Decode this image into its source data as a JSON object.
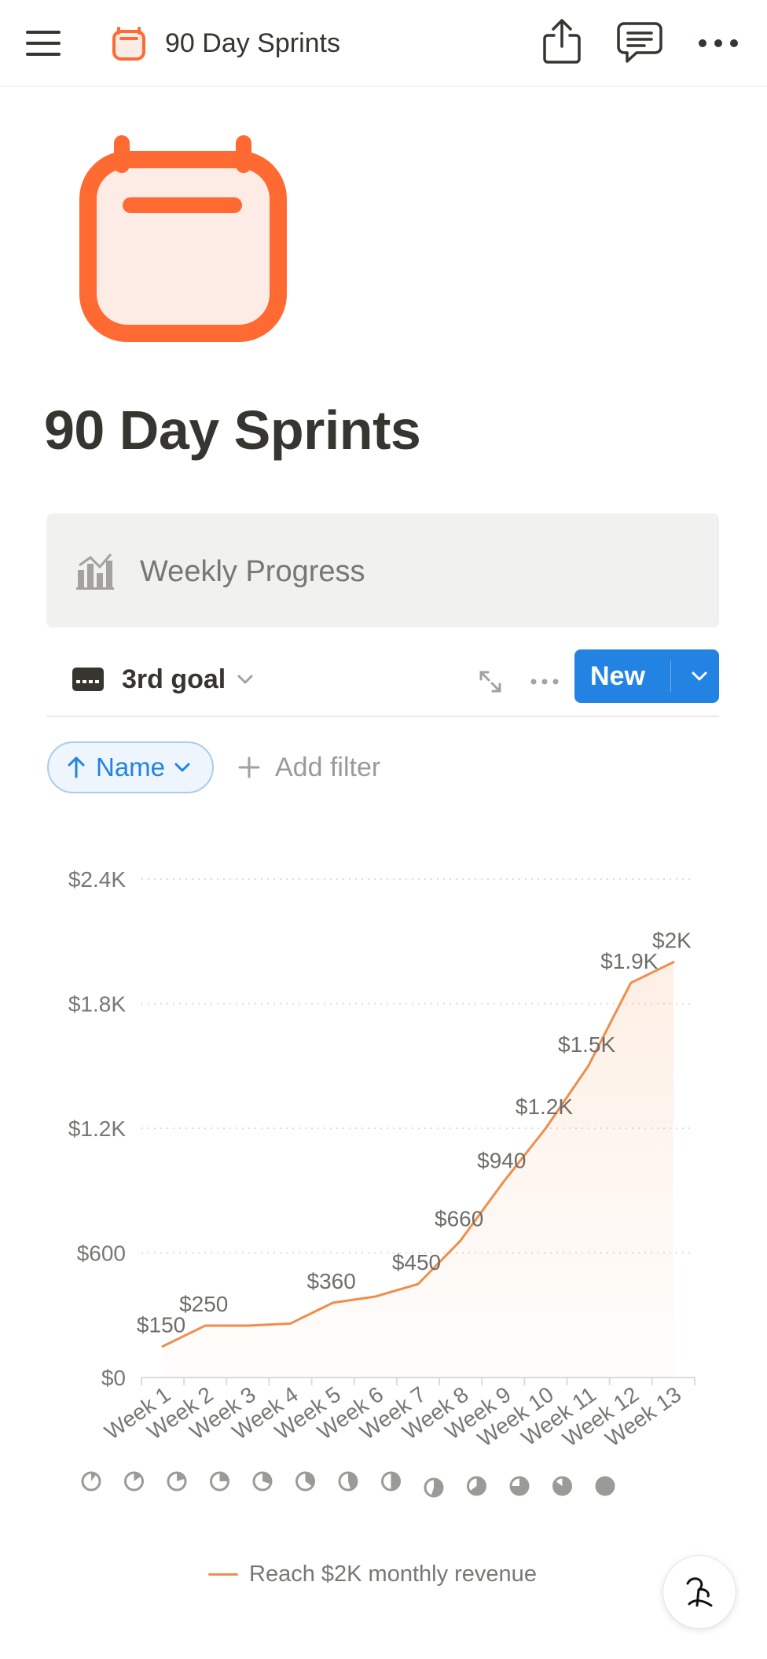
{
  "topbar": {
    "title": "90 Day Sprints",
    "icons": [
      "menu-icon",
      "calendar-icon",
      "share-icon",
      "comment-icon",
      "more-icon"
    ]
  },
  "page": {
    "title": "90 Day Sprints",
    "icon": "calendar-icon",
    "accent_color": "#ff6a33"
  },
  "database": {
    "title": "Weekly Progress",
    "icon": "chart-icon",
    "view": {
      "label": "3rd goal",
      "icon": "card-icon"
    },
    "new_label": "New",
    "new_color": "#2383e2",
    "sort": {
      "label": "Name",
      "direction": "ascending"
    },
    "add_filter_label": "Add filter"
  },
  "chart_data": {
    "type": "area",
    "categories": [
      "Week 1",
      "Week 2",
      "Week 3",
      "Week 4",
      "Week 5",
      "Week 6",
      "Week 7",
      "Week 8",
      "Week 9",
      "Week 10",
      "Week 11",
      "Week 12",
      "Week 13"
    ],
    "series": [
      {
        "name": "Reach $2K monthly revenue",
        "color": "#ef8e4c",
        "values": [
          150,
          250,
          250,
          260,
          360,
          390,
          450,
          660,
          940,
          1200,
          1500,
          1900,
          2000
        ]
      }
    ],
    "data_labels": [
      "$150",
      "$250",
      "",
      "",
      "$360",
      "",
      "$450",
      "$660",
      "$940",
      "$1.2K",
      "$1.5K",
      "$1.9K",
      "$2K"
    ],
    "yticks": [
      {
        "value": 0,
        "label": "$0"
      },
      {
        "value": 600,
        "label": "$600"
      },
      {
        "value": 1200,
        "label": "$1.2K"
      },
      {
        "value": 1800,
        "label": "$1.8K"
      },
      {
        "value": 2400,
        "label": "$2.4K"
      }
    ],
    "ylim": [
      0,
      2400
    ],
    "grid": true,
    "legend": "bottom",
    "progress_fractions": [
      0.1,
      0.15,
      0.2,
      0.25,
      0.3,
      0.35,
      0.45,
      0.5,
      0.55,
      0.65,
      0.75,
      0.85,
      1.0
    ]
  }
}
